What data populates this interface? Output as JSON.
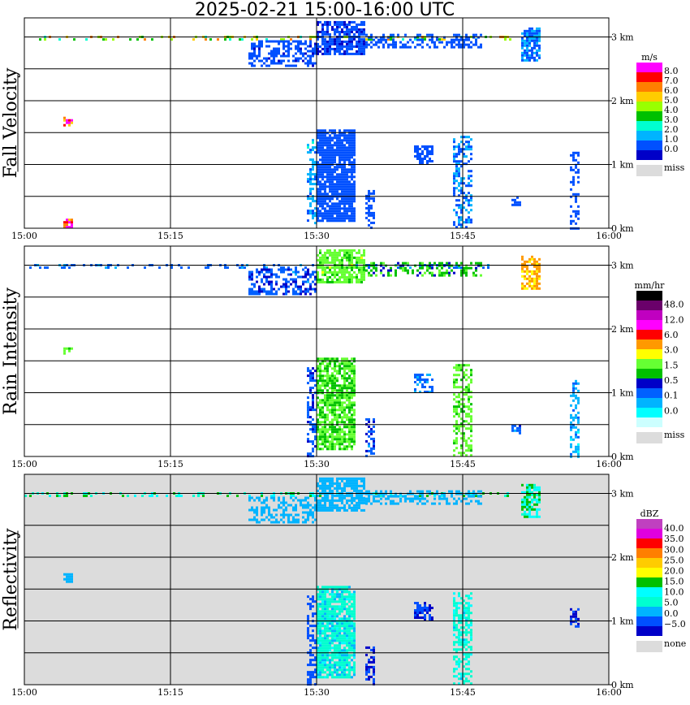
{
  "title": "2025-02-21   15:00-16:00 UTC",
  "colors": {
    "missing_fill": "#dcdcdc",
    "grid": "#000000"
  },
  "chart_data": [
    {
      "type": "heatmap",
      "panel": "fall-velocity",
      "ylabel": "Fall Velocity",
      "x_ticks": [
        "15:00",
        "15:15",
        "15:30",
        "15:45",
        "16:00"
      ],
      "y_ticks": [
        "0 km",
        "1 km",
        "2 km",
        "3 km"
      ],
      "xlim": [
        "15:00",
        "16:00"
      ],
      "ylim": [
        0,
        3.3
      ],
      "background": "#ffffff",
      "colorbar": {
        "title": "m/s",
        "labels": [
          "8.0",
          "7.0",
          "6.0",
          "5.0",
          "4.0",
          "3.0",
          "2.0",
          "1.0",
          "0.0"
        ],
        "colors": [
          "#ff00ff",
          "#ff0000",
          "#ff7f00",
          "#ffcc00",
          "#99ff00",
          "#00c000",
          "#00ffd0",
          "#00b4ff",
          "#0050ff",
          "#0000c8"
        ],
        "missing_label": "miss"
      },
      "echoes": [
        {
          "t0": "15:00",
          "t1": "15:50",
          "h0": 2.95,
          "h1": 3.02,
          "value": 4.5,
          "density": 0.25
        },
        {
          "t0": "15:23",
          "t1": "15:30",
          "h0": 2.55,
          "h1": 2.95,
          "value": 0.6,
          "density": 0.55
        },
        {
          "t0": "15:30",
          "t1": "15:35",
          "h0": 2.75,
          "h1": 3.25,
          "value": 0.5,
          "density": 0.8
        },
        {
          "t0": "15:35",
          "t1": "15:47",
          "h0": 2.85,
          "h1": 3.05,
          "value": 0.7,
          "density": 0.45
        },
        {
          "t0": "15:51",
          "t1": "15:53",
          "h0": 2.65,
          "h1": 3.15,
          "value": 1.2,
          "density": 0.7
        },
        {
          "t0": "15:29",
          "t1": "15:30",
          "h0": 0.0,
          "h1": 1.4,
          "value": 1.6,
          "density": 0.45
        },
        {
          "t0": "15:30",
          "t1": "15:34",
          "h0": 0.1,
          "h1": 1.55,
          "value": 0.8,
          "density": 0.85
        },
        {
          "t0": "15:35",
          "t1": "15:36",
          "h0": 0.0,
          "h1": 0.6,
          "value": 0.8,
          "density": 0.5
        },
        {
          "t0": "15:40",
          "t1": "15:42",
          "h0": 1.0,
          "h1": 1.3,
          "value": 0.8,
          "density": 0.6
        },
        {
          "t0": "15:44",
          "t1": "15:46",
          "h0": 0.0,
          "h1": 1.45,
          "value": 1.2,
          "density": 0.5
        },
        {
          "t0": "15:50",
          "t1": "15:51",
          "h0": 0.35,
          "h1": 0.5,
          "value": 0.8,
          "density": 0.6
        },
        {
          "t0": "15:56",
          "t1": "15:57",
          "h0": 0.0,
          "h1": 1.2,
          "value": 0.8,
          "density": 0.45
        },
        {
          "t0": "15:04",
          "t1": "15:05",
          "h0": 0.0,
          "h1": 0.15,
          "value": 8.2,
          "density": 0.6
        },
        {
          "t0": "15:04",
          "t1": "15:05",
          "h0": 1.6,
          "h1": 1.75,
          "value": 8.2,
          "density": 0.6
        }
      ]
    },
    {
      "type": "heatmap",
      "panel": "rain-intensity",
      "ylabel": "Rain Intensity",
      "x_ticks": [
        "15:00",
        "15:15",
        "15:30",
        "15:45",
        "16:00"
      ],
      "y_ticks": [
        "0 km",
        "1 km",
        "2 km",
        "3 km"
      ],
      "xlim": [
        "15:00",
        "16:00"
      ],
      "ylim": [
        0,
        3.3
      ],
      "background": "#ffffff",
      "colorbar": {
        "title": "mm/hr",
        "labels": [
          "48.0",
          "12.0",
          "6.0",
          "3.0",
          "1.5",
          "0.5",
          "0.1",
          "0.0"
        ],
        "colors": [
          "#000000",
          "#6a006a",
          "#c000c0",
          "#ff00ff",
          "#ff0000",
          "#ff9900",
          "#ffff00",
          "#66ff33",
          "#00c000",
          "#0000c8",
          "#0060ff",
          "#00b4ff",
          "#00ffff",
          "#ccffff"
        ],
        "missing_label": "miss"
      },
      "echoes": [
        {
          "t0": "15:00",
          "t1": "15:50",
          "h0": 2.95,
          "h1": 3.02,
          "value": 0.08,
          "density": 0.3
        },
        {
          "t0": "15:23",
          "t1": "15:30",
          "h0": 2.55,
          "h1": 2.95,
          "value": 0.1,
          "density": 0.5
        },
        {
          "t0": "15:30",
          "t1": "15:35",
          "h0": 2.75,
          "h1": 3.25,
          "value": 0.5,
          "density": 0.75
        },
        {
          "t0": "15:35",
          "t1": "15:47",
          "h0": 2.85,
          "h1": 3.05,
          "value": 0.3,
          "density": 0.45
        },
        {
          "t0": "15:51",
          "t1": "15:53",
          "h0": 2.65,
          "h1": 3.15,
          "value": 1.5,
          "density": 0.7
        },
        {
          "t0": "15:29",
          "t1": "15:30",
          "h0": 0.0,
          "h1": 1.4,
          "value": 0.1,
          "density": 0.4
        },
        {
          "t0": "15:30",
          "t1": "15:34",
          "h0": 0.1,
          "h1": 1.55,
          "value": 0.4,
          "density": 0.8
        },
        {
          "t0": "15:35",
          "t1": "15:36",
          "h0": 0.0,
          "h1": 0.6,
          "value": 0.1,
          "density": 0.5
        },
        {
          "t0": "15:40",
          "t1": "15:42",
          "h0": 1.0,
          "h1": 1.3,
          "value": 0.08,
          "density": 0.55
        },
        {
          "t0": "15:44",
          "t1": "15:46",
          "h0": 0.0,
          "h1": 1.45,
          "value": 0.5,
          "density": 0.5
        },
        {
          "t0": "15:50",
          "t1": "15:51",
          "h0": 0.35,
          "h1": 0.5,
          "value": 0.1,
          "density": 0.6
        },
        {
          "t0": "15:56",
          "t1": "15:57",
          "h0": 0.0,
          "h1": 1.2,
          "value": 0.05,
          "density": 0.45
        },
        {
          "t0": "15:04",
          "t1": "15:05",
          "h0": 1.6,
          "h1": 1.75,
          "value": 0.5,
          "density": 0.6
        }
      ]
    },
    {
      "type": "heatmap",
      "panel": "reflectivity",
      "ylabel": "Reflectivity",
      "x_ticks": [
        "15:00",
        "15:15",
        "15:30",
        "15:45",
        "16:00"
      ],
      "y_ticks": [
        "0 km",
        "1 km",
        "2 km",
        "3 km"
      ],
      "xlim": [
        "15:00",
        "16:00"
      ],
      "ylim": [
        0,
        3.3
      ],
      "background": "#dcdcdc",
      "colorbar": {
        "title": "dBZ",
        "labels": [
          "40.0",
          "35.0",
          "30.0",
          "25.0",
          "20.0",
          "15.0",
          "10.0",
          "5.0",
          "0.0",
          "−5.0"
        ],
        "colors": [
          "#c040c0",
          "#e000e0",
          "#ff0000",
          "#ff7f00",
          "#ffcc00",
          "#ffff00",
          "#00c000",
          "#00ffff",
          "#00ffd0",
          "#00b4ff",
          "#0050ff",
          "#0000c8"
        ],
        "missing_label": "none"
      },
      "echoes": [
        {
          "t0": "15:00",
          "t1": "15:50",
          "h0": 2.95,
          "h1": 3.02,
          "value": 12,
          "density": 0.3
        },
        {
          "t0": "15:23",
          "t1": "15:30",
          "h0": 2.55,
          "h1": 2.95,
          "value": 3,
          "density": 0.5
        },
        {
          "t0": "15:30",
          "t1": "15:35",
          "h0": 2.75,
          "h1": 3.25,
          "value": 3,
          "density": 0.75
        },
        {
          "t0": "15:35",
          "t1": "15:47",
          "h0": 2.85,
          "h1": 3.05,
          "value": 2,
          "density": 0.45
        },
        {
          "t0": "15:51",
          "t1": "15:53",
          "h0": 2.65,
          "h1": 3.15,
          "value": 12,
          "density": 0.7
        },
        {
          "t0": "15:29",
          "t1": "15:30",
          "h0": 0.0,
          "h1": 1.4,
          "value": 0,
          "density": 0.45
        },
        {
          "t0": "15:30",
          "t1": "15:34",
          "h0": 0.1,
          "h1": 1.55,
          "value": 7,
          "density": 0.85
        },
        {
          "t0": "15:35",
          "t1": "15:36",
          "h0": 0.0,
          "h1": 0.6,
          "value": -3,
          "density": 0.5
        },
        {
          "t0": "15:40",
          "t1": "15:42",
          "h0": 1.0,
          "h1": 1.3,
          "value": -3,
          "density": 0.6
        },
        {
          "t0": "15:44",
          "t1": "15:46",
          "h0": 0.0,
          "h1": 1.45,
          "value": 8,
          "density": 0.5
        },
        {
          "t0": "15:56",
          "t1": "15:57",
          "h0": 0.9,
          "h1": 1.2,
          "value": -3,
          "density": 0.5
        },
        {
          "t0": "15:04",
          "t1": "15:05",
          "h0": 1.6,
          "h1": 1.75,
          "value": 3,
          "density": 0.6
        }
      ]
    }
  ]
}
